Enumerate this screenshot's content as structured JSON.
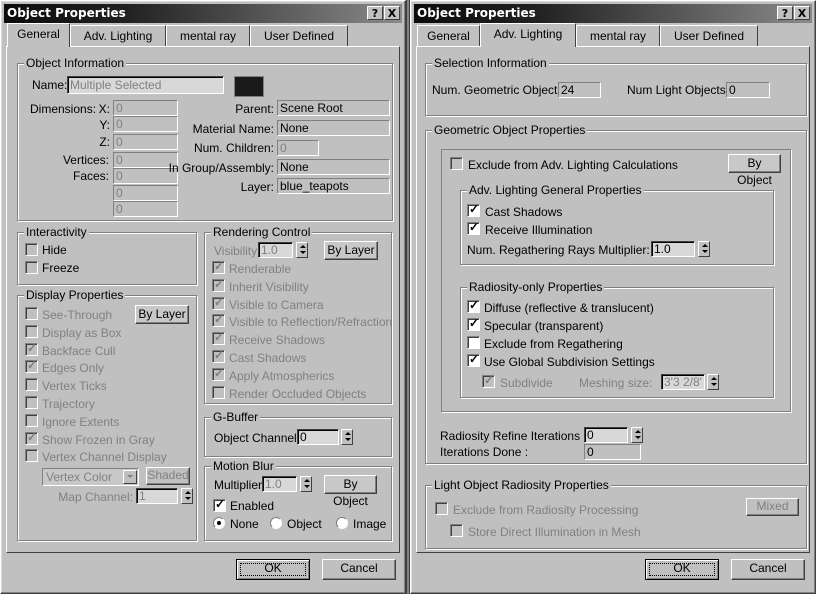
{
  "left_dialog": {
    "title": "Object Properties",
    "help_button": "?",
    "close_button": "X",
    "tabs": [
      {
        "label": "General",
        "active": true
      },
      {
        "label": "Adv. Lighting",
        "active": false
      },
      {
        "label": "mental ray",
        "active": false
      },
      {
        "label": "User Defined",
        "active": false
      }
    ],
    "object_information": {
      "title": "Object Information",
      "name_label": "Name:",
      "name_value": "Multiple Selected",
      "color_swatch": "#1a1a1a",
      "dimensions_label": "Dimensions:",
      "x_label": "X:",
      "x_value": "0",
      "y_label": "Y:",
      "y_value": "0",
      "z_label": "Z:",
      "z_value": "0",
      "vertices_label": "Vertices:",
      "vertices_value": "0",
      "faces_label": "Faces:",
      "faces_value": "0",
      "extra_values": [
        "0",
        "0"
      ],
      "parent_label": "Parent:",
      "parent_value": "Scene Root",
      "material_label": "Material Name:",
      "material_value": "None",
      "children_label": "Num. Children:",
      "children_value": "0",
      "group_label": "In Group/Assembly:",
      "group_value": "None",
      "layer_label": "Layer:",
      "layer_value": "blue_teapots"
    },
    "interactivity": {
      "title": "Interactivity",
      "items": [
        {
          "label": "Hide",
          "checked": false
        },
        {
          "label": "Freeze",
          "checked": false
        }
      ]
    },
    "display_properties": {
      "title": "Display Properties",
      "by_layer_button": "By Layer",
      "items": [
        {
          "label": "See-Through",
          "checked": false
        },
        {
          "label": "Display as Box",
          "checked": false
        },
        {
          "label": "Backface Cull",
          "checked": true
        },
        {
          "label": "Edges Only",
          "checked": true
        },
        {
          "label": "Vertex Ticks",
          "checked": false
        },
        {
          "label": "Trajectory",
          "checked": false
        },
        {
          "label": "Ignore Extents",
          "checked": false
        },
        {
          "label": "Show Frozen in Gray",
          "checked": true
        },
        {
          "label": "Vertex Channel Display",
          "checked": false
        }
      ],
      "vertex_dropdown_value": "Vertex Color",
      "shaded_button": "Shaded",
      "map_channel_label": "Map Channel:",
      "map_channel_value": "1"
    },
    "rendering_control": {
      "title": "Rendering Control",
      "visibility_label": "Visibility:",
      "visibility_value": "1.0",
      "by_layer_button": "By Layer",
      "items": [
        {
          "label": "Renderable",
          "checked": true
        },
        {
          "label": "Inherit Visibility",
          "checked": true
        },
        {
          "label": "Visible to Camera",
          "checked": true
        },
        {
          "label": "Visible to Reflection/Refraction",
          "checked": true
        },
        {
          "label": "Receive Shadows",
          "checked": true
        },
        {
          "label": "Cast Shadows",
          "checked": true
        },
        {
          "label": "Apply Atmospherics",
          "checked": true
        },
        {
          "label": "Render Occluded Objects",
          "checked": false
        }
      ]
    },
    "g_buffer": {
      "title": "G-Buffer",
      "channel_label": "Object Channel:",
      "channel_value": "0"
    },
    "motion_blur": {
      "title": "Motion Blur",
      "multiplier_label": "Multiplier:",
      "multiplier_value": "1.0",
      "by_object_button": "By Object",
      "enabled_label": "Enabled",
      "enabled_checked": true,
      "radios": [
        {
          "label": "None",
          "selected": true
        },
        {
          "label": "Object",
          "selected": false
        },
        {
          "label": "Image",
          "selected": false
        }
      ]
    },
    "ok_button": "OK",
    "cancel_button": "Cancel"
  },
  "right_dialog": {
    "title": "Object Properties",
    "help_button": "?",
    "close_button": "X",
    "tabs": [
      {
        "label": "General",
        "active": false
      },
      {
        "label": "Adv. Lighting",
        "active": true
      },
      {
        "label": "mental ray",
        "active": false
      },
      {
        "label": "User Defined",
        "active": false
      }
    ],
    "selection_information": {
      "title": "Selection Information",
      "geo_label": "Num. Geometric Objects:",
      "geo_value": "24",
      "light_label": "Num Light Objects:",
      "light_value": "0"
    },
    "geometric_object_properties": {
      "title": "Geometric Object Properties",
      "exclude_label": "Exclude from Adv. Lighting Calculations",
      "exclude_checked": false,
      "by_object_button": "By Object",
      "general": {
        "title": "Adv. Lighting General Properties",
        "items": [
          {
            "label": "Cast Shadows",
            "checked": true
          },
          {
            "label": "Receive Illumination",
            "checked": true
          }
        ],
        "rays_label": "Num. Regathering Rays Multiplier:",
        "rays_value": "1.0"
      },
      "radiosity_only": {
        "title": "Radiosity-only Properties",
        "items": [
          {
            "label": "Diffuse (reflective & translucent)",
            "checked": true
          },
          {
            "label": "Specular (transparent)",
            "checked": true
          },
          {
            "label": "Exclude from Regathering",
            "checked": false
          },
          {
            "label": "Use Global Subdivision Settings",
            "checked": true
          }
        ],
        "subdivide_label": "Subdivide",
        "subdivide_checked": true,
        "meshing_label": "Meshing size:",
        "meshing_value": "3'3 2/8'"
      },
      "refine_label": "Radiosity Refine Iterations :",
      "refine_value": "0",
      "done_label": "Iterations Done :",
      "done_value": "0"
    },
    "light_object_radiosity": {
      "title": "Light Object Radiosity Properties",
      "exclude_label": "Exclude from Radiosity Processing",
      "exclude_checked": false,
      "mixed_button": "Mixed",
      "store_label": "Store Direct Illumination in Mesh",
      "store_checked": false
    },
    "ok_button": "OK",
    "cancel_button": "Cancel"
  }
}
